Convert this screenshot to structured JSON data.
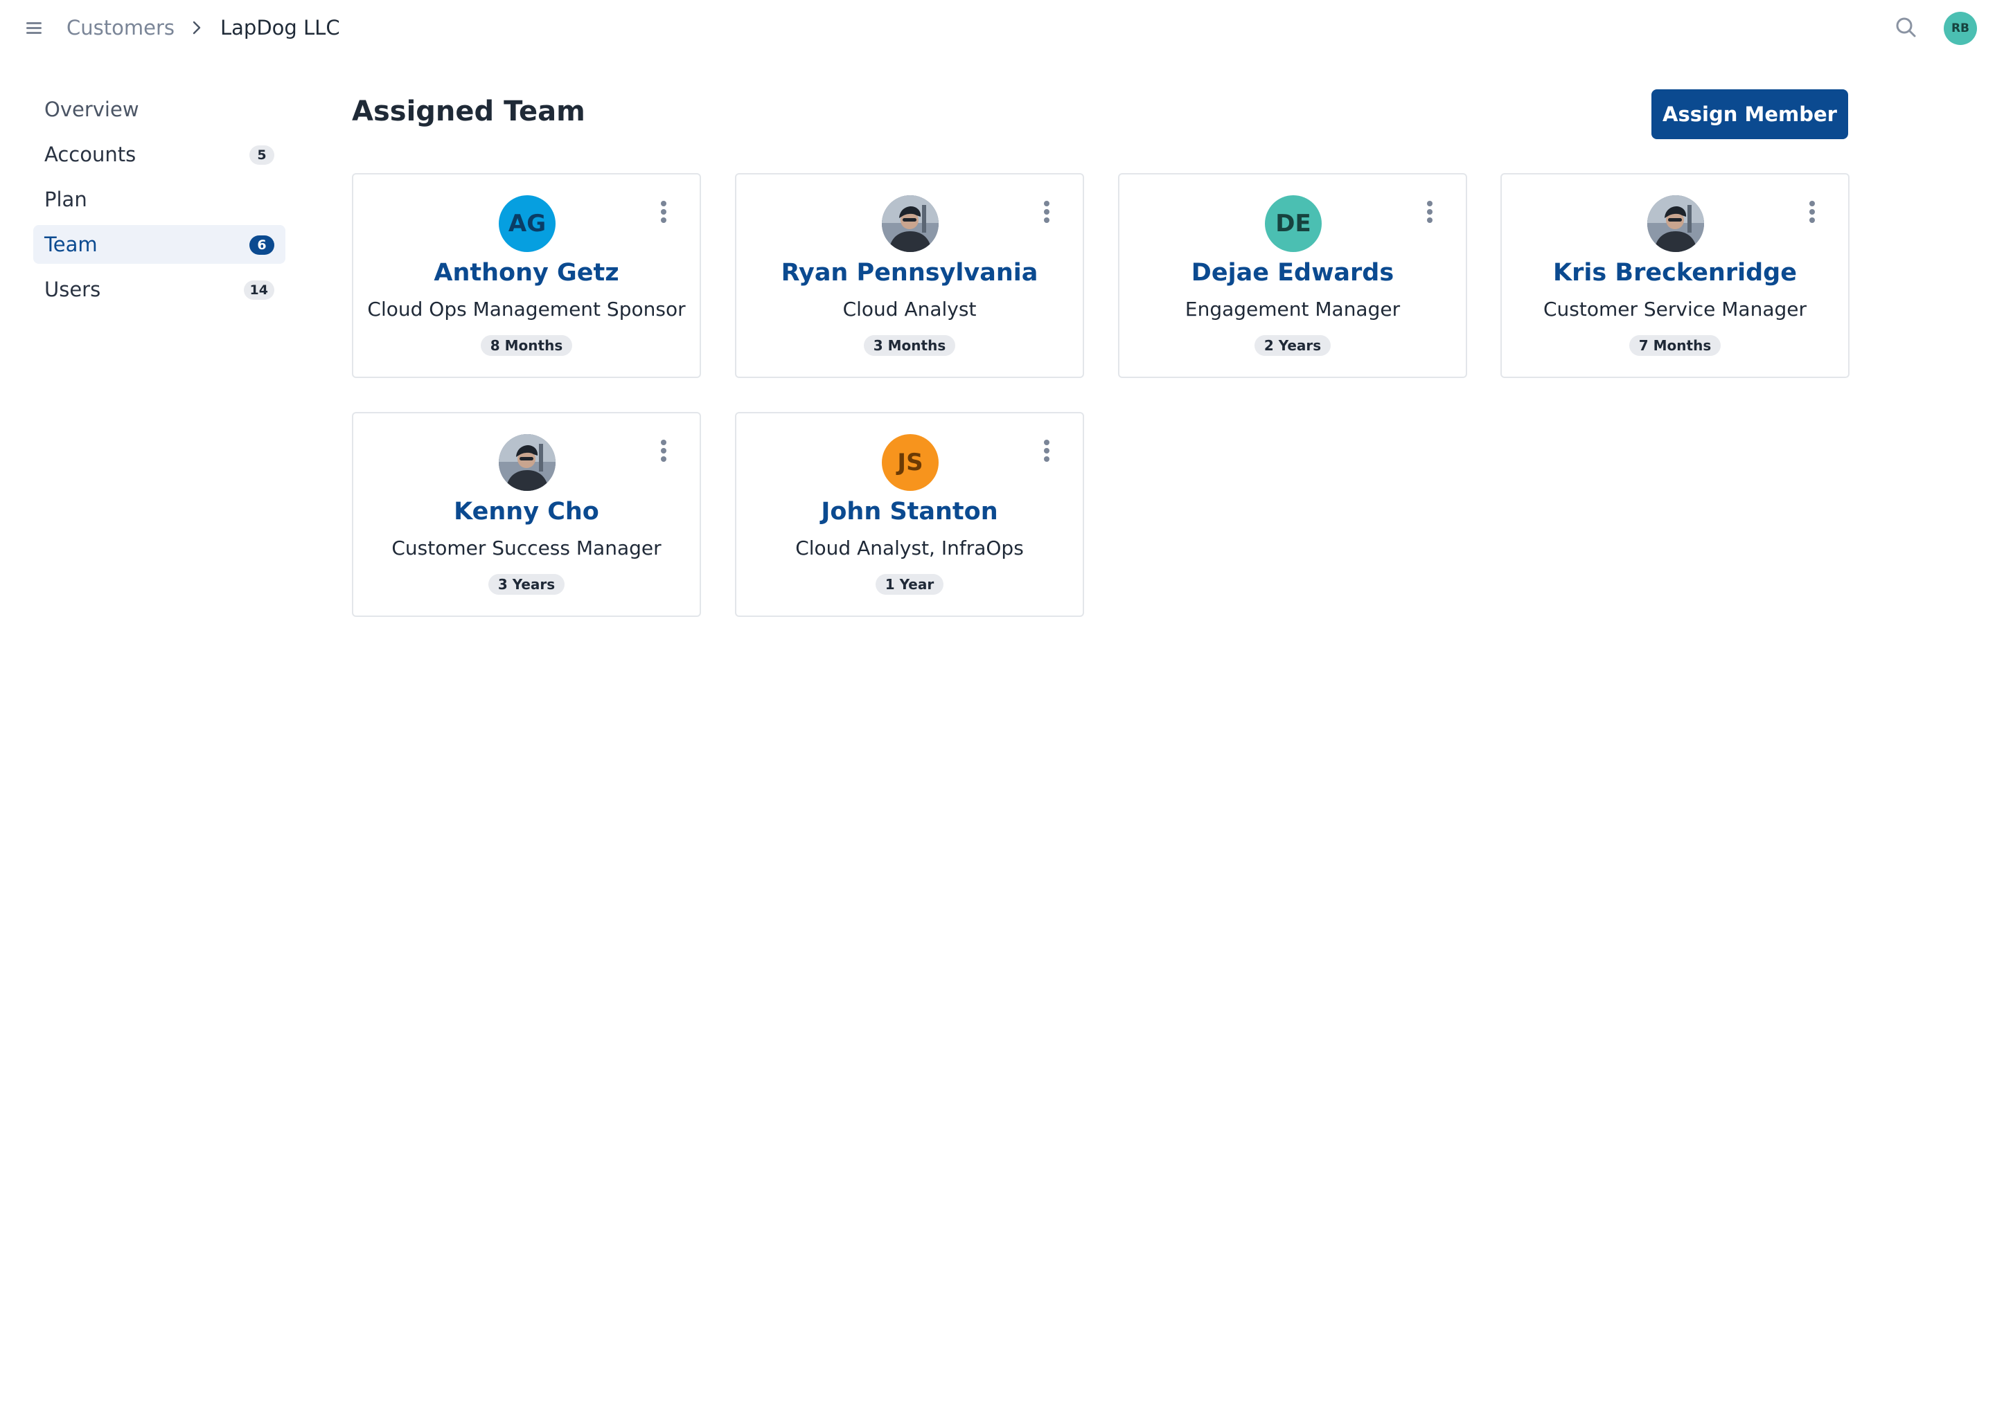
{
  "breadcrumb": {
    "parent": "Customers",
    "current": "LapDog LLC"
  },
  "header": {
    "user_initials": "RB",
    "user_avatar_color": "#4bbfb2"
  },
  "sidebar": {
    "items": [
      {
        "label": "Overview",
        "badge": null,
        "active": false
      },
      {
        "label": "Accounts",
        "badge": "5",
        "active": false
      },
      {
        "label": "Plan",
        "badge": null,
        "active": false
      },
      {
        "label": "Team",
        "badge": "6",
        "active": true
      },
      {
        "label": "Users",
        "badge": "14",
        "active": false
      }
    ]
  },
  "main": {
    "title": "Assigned Team",
    "assign_label": "Assign Member"
  },
  "team": {
    "members": [
      {
        "name": "Anthony Getz",
        "role": "Cloud Ops Management Sponsor",
        "tenure": "8 Months",
        "avatar": "initials",
        "initials": "AG",
        "avatar_color": "#069fe0",
        "avatar_text_color": "#0a3d66"
      },
      {
        "name": "Ryan Pennsylvania",
        "role": "Cloud Analyst",
        "tenure": "3 Months",
        "avatar": "photo"
      },
      {
        "name": "Dejae Edwards",
        "role": "Engagement Manager",
        "tenure": "2 Years",
        "avatar": "initials",
        "initials": "DE",
        "avatar_color": "#4bbfb2",
        "avatar_text_color": "#17433f"
      },
      {
        "name": "Kris Breckenridge",
        "role": "Customer Service Manager",
        "tenure": "7 Months",
        "avatar": "photo"
      },
      {
        "name": "Kenny Cho",
        "role": "Customer Success Manager",
        "tenure": "3 Years",
        "avatar": "photo"
      },
      {
        "name": "John Stanton",
        "role": "Cloud Analyst, InfraOps",
        "tenure": "1 Year",
        "avatar": "initials",
        "initials": "JS",
        "avatar_color": "#f7941d",
        "avatar_text_color": "#6b3a05"
      }
    ]
  },
  "colors": {
    "primary": "#0b4a90",
    "active_nav_bg": "#eef2f9",
    "badge_bg": "#e8eaee",
    "card_border": "#e3e6ea"
  }
}
